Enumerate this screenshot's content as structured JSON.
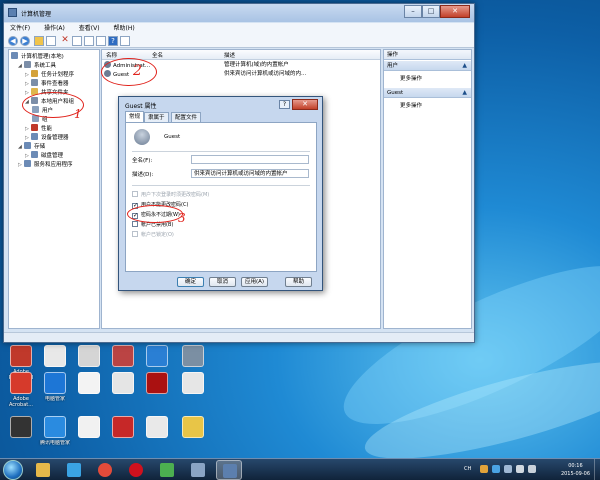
{
  "window": {
    "title": "计算机管理",
    "minimize": "–",
    "maximize": "□",
    "close": "✕",
    "menu": [
      "文件(F)",
      "操作(A)",
      "查看(V)",
      "帮助(H)"
    ],
    "toolbar_icons": [
      "back-icon",
      "forward-icon",
      "up-icon",
      "show-tree-icon",
      "delete-icon",
      "properties-icon",
      "refresh-icon",
      "export-icon",
      "help-icon",
      "view-icon"
    ]
  },
  "tree": {
    "root": "计算机管理(本地)",
    "items": [
      {
        "label": "系统工具",
        "level": 1
      },
      {
        "label": "任务计划程序",
        "level": 2
      },
      {
        "label": "事件查看器",
        "level": 2
      },
      {
        "label": "共享文件夹",
        "level": 2
      },
      {
        "label": "本地用户和组",
        "level": 2
      },
      {
        "label": "用户",
        "level": 3
      },
      {
        "label": "组",
        "level": 3
      },
      {
        "label": "性能",
        "level": 2
      },
      {
        "label": "设备管理器",
        "level": 2
      },
      {
        "label": "存储",
        "level": 1
      },
      {
        "label": "磁盘管理",
        "level": 2
      },
      {
        "label": "服务和应用程序",
        "level": 1
      }
    ]
  },
  "list": {
    "columns": [
      "名称",
      "全名",
      "描述"
    ],
    "rows": [
      {
        "name": "Administrat...",
        "fullname": "",
        "desc": "管理计算机(域)的内置帐户"
      },
      {
        "name": "Guest",
        "fullname": "",
        "desc": "供来宾访问计算机或访问域的内..."
      }
    ]
  },
  "actions": {
    "title": "操作",
    "sections": [
      {
        "header": "用户",
        "more": "更多操作"
      },
      {
        "header": "Guest",
        "more": "更多操作"
      }
    ]
  },
  "dialog": {
    "title": "Guest 属性",
    "help": "?",
    "close": "✕",
    "tabs": [
      "常规",
      "隶属于",
      "配置文件"
    ],
    "username": "Guest",
    "fullname_label": "全名(F):",
    "fullname_value": "",
    "desc_label": "描述(D):",
    "desc_value": "供来宾访问计算机或访问域的内置帐户",
    "checkboxes": [
      {
        "label": "用户下次登录时须更改密码(M)",
        "checked": false,
        "disabled": true
      },
      {
        "label": "用户不能更改密码(C)",
        "checked": true,
        "disabled": false
      },
      {
        "label": "密码永不过期(W)",
        "checked": true,
        "disabled": false
      },
      {
        "label": "帐户已禁用(B)",
        "checked": false,
        "disabled": false
      },
      {
        "label": "帐户已锁定(O)",
        "checked": false,
        "disabled": true
      }
    ],
    "buttons": [
      "确定",
      "取消",
      "应用(A)",
      "帮助"
    ]
  },
  "annotations": [
    "1",
    "2",
    "3"
  ],
  "desktop_icons": [
    {
      "label": "Adobe Reader XI",
      "color": "#c0392b"
    },
    {
      "label": "",
      "color": "#e8e8e8"
    },
    {
      "label": "",
      "color": "#d5d5d5"
    },
    {
      "label": "",
      "color": "#b44"
    },
    {
      "label": "",
      "color": "#2a7fd4"
    },
    {
      "label": "",
      "color": "#7b8fa3"
    },
    {
      "label": "Adobe Acrobat...",
      "color": "#d63a2b"
    },
    {
      "label": "电脑管家",
      "color": "#1d76d6"
    },
    {
      "label": "",
      "color": "#f3f3f3"
    },
    {
      "label": "",
      "color": "#e5e5e5"
    },
    {
      "label": "",
      "color": "#a11"
    },
    {
      "label": "",
      "color": "#e6e6e6"
    },
    {
      "label": "",
      "color": "#333"
    },
    {
      "label": "腾讯电脑管家",
      "color": "#2a8be0"
    },
    {
      "label": "",
      "color": "#f1f1f1"
    },
    {
      "label": "",
      "color": "#c62828"
    },
    {
      "label": "",
      "color": "#e9e9e9"
    },
    {
      "label": "",
      "color": "#e8c547"
    }
  ],
  "taskbar": {
    "apps": [
      {
        "name": "explorer-icon",
        "color": "#e6b84a"
      },
      {
        "name": "browser-icon",
        "color": "#3aa3e3"
      },
      {
        "name": "chrome-icon",
        "color": "#e34b3a"
      },
      {
        "name": "opera-icon",
        "color": "#d0111e"
      },
      {
        "name": "app-icon",
        "color": "#4caf50"
      },
      {
        "name": "tools-icon",
        "color": "#8aa4c4"
      },
      {
        "name": "computer-management-icon",
        "color": "#5c7fae"
      }
    ],
    "lang": "CH",
    "time": "00:16",
    "date": "2015-09-06"
  }
}
